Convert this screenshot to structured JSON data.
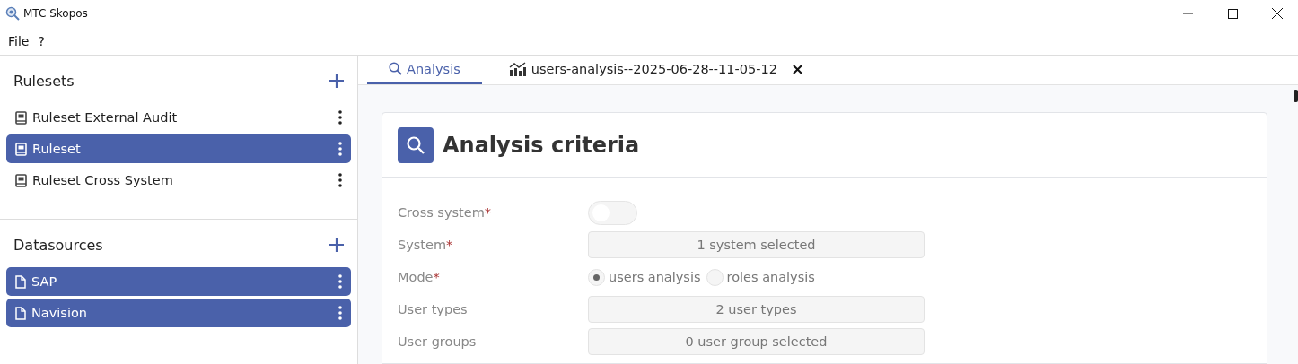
{
  "window": {
    "title": "MTC Skopos"
  },
  "menu": [
    "File",
    "?"
  ],
  "rulesets": {
    "title": "Rulesets",
    "items": [
      {
        "label": "Ruleset External Audit",
        "selected": false
      },
      {
        "label": "Ruleset",
        "selected": true
      },
      {
        "label": "Ruleset Cross System",
        "selected": false
      }
    ]
  },
  "datasources": {
    "title": "Datasources",
    "items": [
      {
        "label": "SAP",
        "selected": true
      },
      {
        "label": "Navision",
        "selected": true
      }
    ]
  },
  "tabs": [
    {
      "label": "Analysis",
      "kind": "search",
      "selected": true
    },
    {
      "label": "users-analysis--2025-06-28--11-05-12",
      "kind": "chart",
      "selected": false,
      "close": "×"
    }
  ],
  "card": {
    "title": "Analysis criteria",
    "fields": [
      {
        "label": "Cross system",
        "required_mark": "*",
        "kind": "toggle",
        "on": false
      },
      {
        "label": "System",
        "required_mark": "*",
        "kind": "select",
        "value": "1 system selected"
      },
      {
        "label": "Mode",
        "required_mark": "*",
        "kind": "radio",
        "options": [
          {
            "label": "users analysis",
            "selected": true
          },
          {
            "label": "roles analysis",
            "selected": false
          }
        ]
      },
      {
        "label": "User types",
        "kind": "select",
        "value": "2 user types"
      },
      {
        "label": "User groups",
        "kind": "select",
        "value": "0 user group selected"
      }
    ]
  }
}
